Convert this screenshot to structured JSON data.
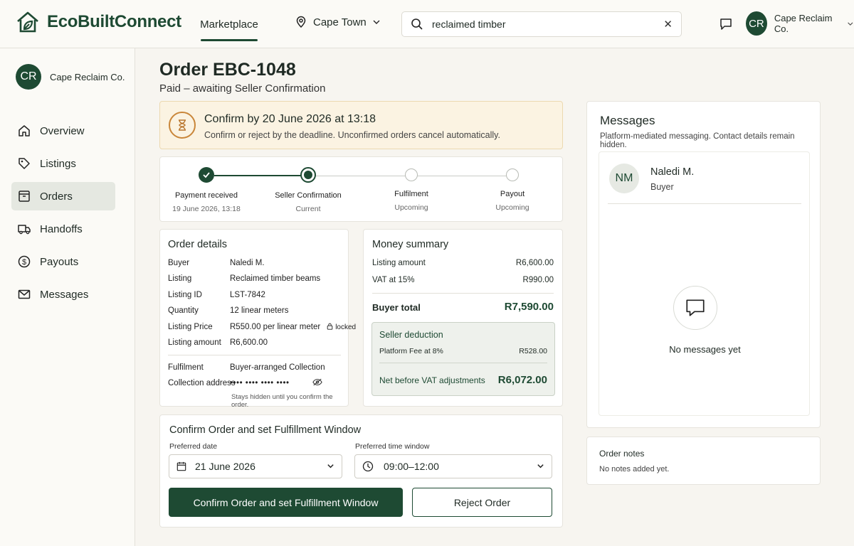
{
  "header": {
    "brand": "EcoBuiltConnect",
    "nav_marketplace": "Marketplace",
    "location": "Cape Town",
    "search_value": "reclaimed timber",
    "user_initials": "CR",
    "user_name": "Cape Reclaim Co."
  },
  "sidebar": {
    "profile_initials": "CR",
    "profile_name": "Cape Reclaim Co.",
    "items": [
      {
        "label": "Overview"
      },
      {
        "label": "Listings"
      },
      {
        "label": "Orders",
        "active": true
      },
      {
        "label": "Handoffs"
      },
      {
        "label": "Payouts"
      },
      {
        "label": "Messages"
      }
    ]
  },
  "order": {
    "title": "Order EBC-1048",
    "status": "Paid – awaiting Seller Confirmation"
  },
  "deadline": {
    "title": "Confirm by 20 June 2026 at 13:18",
    "text": "Confirm or reject by the deadline. Unconfirmed orders cancel automatically."
  },
  "progress": {
    "steps": [
      {
        "label": "Payment received",
        "sub": "19 June 2026, 13:18",
        "state": "done"
      },
      {
        "label": "Seller Confirmation",
        "sub": "Current",
        "state": "current"
      },
      {
        "label": "Fulfilment",
        "sub": "Upcoming",
        "state": "upcoming"
      },
      {
        "label": "Payout",
        "sub": "Upcoming",
        "state": "upcoming"
      }
    ]
  },
  "details": {
    "title": "Order details",
    "rows": [
      {
        "k": "Buyer",
        "v": "Naledi M."
      },
      {
        "k": "Listing",
        "v": "Reclaimed timber beams"
      },
      {
        "k": "Listing ID",
        "v": "LST-7842"
      },
      {
        "k": "Quantity",
        "v": "12 linear meters"
      },
      {
        "k": "Listing Price",
        "v": "R550.00 per linear meter"
      },
      {
        "k": "Listing amount",
        "v": "R6,600.00"
      }
    ],
    "locked_label": "locked",
    "fulfilment_key": "Fulfilment",
    "fulfilment_value": "Buyer-arranged Collection",
    "address_key": "Collection address",
    "address_value": "•••• •••• •••• ••••",
    "address_hint": "Stays hidden until you confirm the order."
  },
  "money": {
    "title": "Money summary",
    "listing_amount_label": "Listing amount",
    "listing_amount": "R6,600.00",
    "vat_label": "VAT at 15%",
    "vat": "R990.00",
    "buyer_total_label": "Buyer total",
    "buyer_total": "R7,590.00",
    "deduction_title": "Seller deduction",
    "fee_label": "Platform Fee at 8%",
    "fee": "R528.00",
    "net_label": "Net before VAT adjustments",
    "net": "R6,072.00"
  },
  "confirm": {
    "title": "Confirm Order and set Fulfillment Window",
    "date_label": "Preferred date",
    "date_value": "21 June 2026",
    "time_label": "Preferred time window",
    "time_value": "09:00–12:00",
    "confirm_button": "Confirm Order and set Fulfillment Window",
    "reject_button": "Reject Order"
  },
  "messages": {
    "title": "Messages",
    "subtitle": "Platform-mediated messaging. Contact details remain hidden.",
    "contact_initials": "NM",
    "contact_name": "Naledi M.",
    "contact_role": "Buyer",
    "empty": "No messages yet"
  },
  "notes": {
    "title": "Order notes",
    "empty": "No notes added yet."
  },
  "colors": {
    "brand": "#1e4a33",
    "warning_bg": "#fbf3e2",
    "deduction_bg": "#eef1ec"
  }
}
